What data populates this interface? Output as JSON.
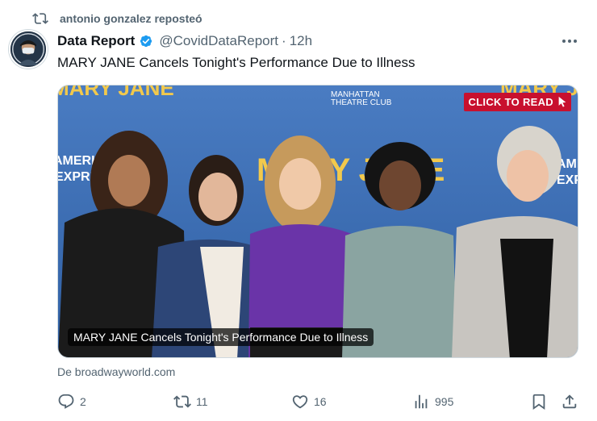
{
  "repost": {
    "text": "antonio gonzalez reposteó"
  },
  "author": {
    "name": "Data Report",
    "handle": "@CovidDataReport",
    "separator": "·",
    "time": "12h"
  },
  "tweet": {
    "text": "MARY JANE Cancels Tonight's Performance Due to Illness"
  },
  "card": {
    "cta_label": "CLICK TO READ",
    "caption": "MARY JANE Cancels Tonight's Performance Due to Illness",
    "backdrop_text": [
      "MANHATTAN",
      "THEATRE CLUB",
      "MARY JANE",
      "AMERICAN",
      "EXPRESS"
    ]
  },
  "source": {
    "text": "De broadwayworld.com"
  },
  "metrics": {
    "replies": "2",
    "reposts": "11",
    "likes": "16",
    "views": "995"
  },
  "colors": {
    "verified": "#1d9bf0",
    "muted": "#536471",
    "cta": "#c8102e",
    "backdrop": "#3d6fb5"
  },
  "icons": [
    "repost-icon",
    "verified-badge-icon",
    "more-icon",
    "cursor-icon",
    "reply-icon",
    "retweet-icon",
    "like-icon",
    "views-icon",
    "bookmark-icon",
    "share-icon"
  ]
}
